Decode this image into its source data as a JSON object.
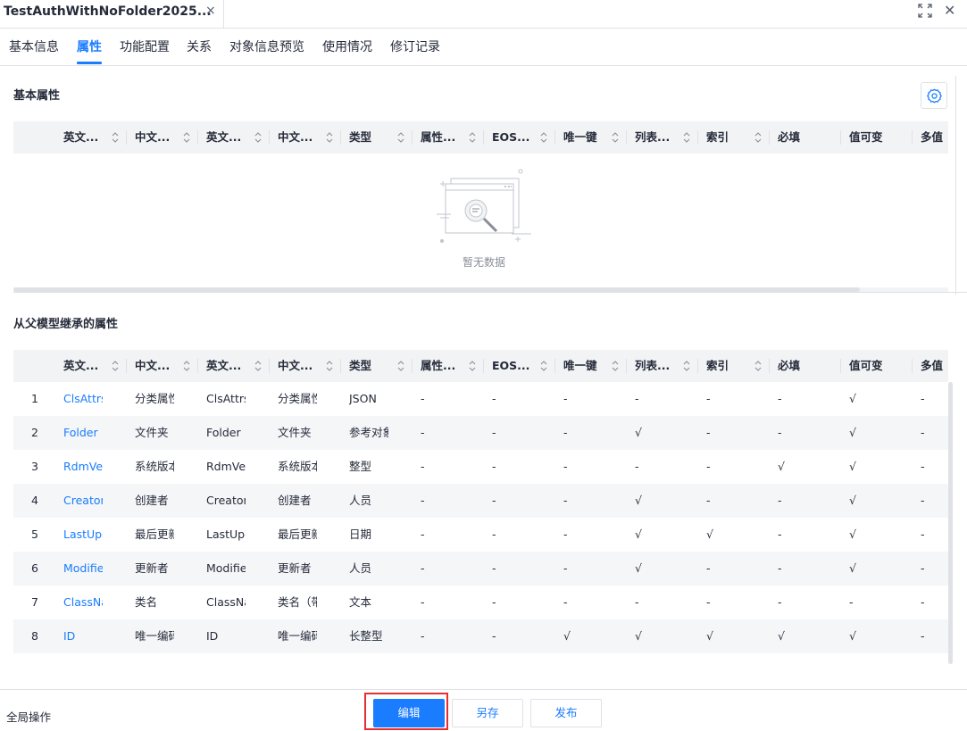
{
  "document_tab": {
    "title": "TestAuthWithNoFolder2025...",
    "close_glyph": "×"
  },
  "window_controls": {
    "expand_icon": "expand-icon",
    "close_glyph": "✕"
  },
  "subtabs": [
    {
      "label": "基本信息",
      "active": false
    },
    {
      "label": "属性",
      "active": true
    },
    {
      "label": "功能配置",
      "active": false
    },
    {
      "label": "关系",
      "active": false
    },
    {
      "label": "对象信息预览",
      "active": false
    },
    {
      "label": "使用情况",
      "active": false
    },
    {
      "label": "修订记录",
      "active": false
    }
  ],
  "basic_section": {
    "title": "基本属性",
    "settings_icon": "gear-icon",
    "empty_text": "暂无数据"
  },
  "inherited_section": {
    "title": "从父模型继承的属性"
  },
  "columns": [
    "英文...",
    "中文...",
    "英文...",
    "中文...",
    "类型",
    "属性...",
    "EOS...",
    "唯一键",
    "列表...",
    "索引",
    "必填",
    "值可变",
    "多值"
  ],
  "rows": [
    [
      "1",
      "ClsAttrs",
      "分类属性",
      "ClsAttrs",
      "分类属性",
      "JSON",
      "-",
      "-",
      "-",
      "-",
      "-",
      "-",
      "√",
      "-"
    ],
    [
      "2",
      "Folder",
      "文件夹",
      "Folder",
      "文件夹",
      "参考对象",
      "-",
      "-",
      "-",
      "√",
      "-",
      "-",
      "√",
      "-"
    ],
    [
      "3",
      "RdmVers...",
      "系统版本",
      "RdmVers...",
      "系统版本",
      "整型",
      "-",
      "-",
      "-",
      "-",
      "-",
      "√",
      "√",
      "-"
    ],
    [
      "4",
      "Creator",
      "创建者",
      "Creator",
      "创建者",
      "人员",
      "-",
      "-",
      "-",
      "√",
      "-",
      "-",
      "√",
      "-"
    ],
    [
      "5",
      "LastUpd...",
      "最后更新...",
      "LastUpd...",
      "最后更新...",
      "日期",
      "-",
      "-",
      "-",
      "√",
      "√",
      "-",
      "√",
      "-"
    ],
    [
      "6",
      "Modifier",
      "更新者",
      "Modifier",
      "更新者",
      "人员",
      "-",
      "-",
      "-",
      "√",
      "-",
      "-",
      "√",
      "-"
    ],
    [
      "7",
      "ClassNa...",
      "类名",
      "ClassNa...",
      "类名（带...",
      "文本",
      "-",
      "-",
      "-",
      "-",
      "-",
      "-",
      "-",
      "-"
    ],
    [
      "8",
      "ID",
      "唯一编码",
      "ID",
      "唯一编码",
      "长整型",
      "-",
      "-",
      "√",
      "√",
      "√",
      "√",
      "√",
      "-"
    ]
  ],
  "footer": {
    "label": "全局操作",
    "edit_label": "编辑",
    "saveas_label": "另存",
    "publish_label": "发布"
  },
  "colors": {
    "accent": "#1a7cff",
    "highlight": "#e62e2e",
    "header_bg": "#f2f3f5",
    "zebra_bg": "#f5f6f8"
  }
}
